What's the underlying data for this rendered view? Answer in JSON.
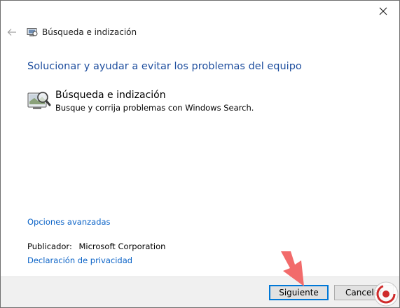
{
  "window": {
    "title": "Búsqueda e indización"
  },
  "heading": "Solucionar y ayudar a evitar los problemas del equipo",
  "item": {
    "title": "Búsqueda e indización",
    "description": "Busque y corrija problemas con Windows Search.",
    "icon": "search-indexing-icon"
  },
  "links": {
    "advanced": "Opciones avanzadas",
    "privacy": "Declaración de privacidad"
  },
  "publisher": {
    "label": "Publicador:",
    "value": "Microsoft Corporation"
  },
  "buttons": {
    "next": "Siguiente",
    "cancel": "Cancelar"
  },
  "colors": {
    "heading": "#1e4e9e",
    "link": "#0b63c7",
    "accent": "#0078d7",
    "arrow": "#f26b6b"
  }
}
